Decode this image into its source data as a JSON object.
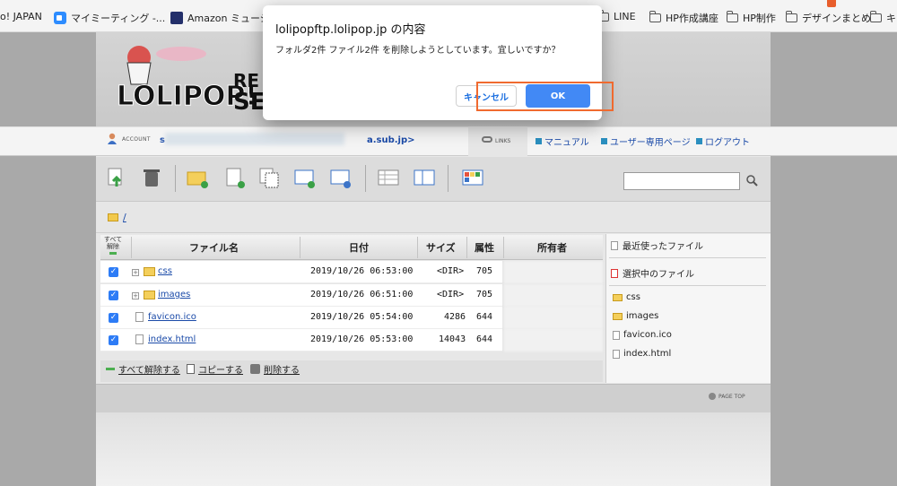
{
  "bookmarks": [
    {
      "label": "o! JAPAN",
      "icon": "yahoo-icon"
    },
    {
      "label": "マイミーティング -...",
      "icon": "zoom-icon"
    },
    {
      "label": "Amazon ミュージ",
      "icon": "amazon-music-icon"
    },
    {
      "label": "LINE",
      "icon": "folder-icon"
    },
    {
      "label": "HP作成講座",
      "icon": "folder-icon"
    },
    {
      "label": "HP制作",
      "icon": "folder-icon"
    },
    {
      "label": "デザインまとめ",
      "icon": "folder-icon"
    },
    {
      "label": "キ",
      "icon": "folder-icon"
    }
  ],
  "header": {
    "account_label": "ACCOUNT",
    "account_prefix": "s",
    "account_suffix": "a.sub.jp>",
    "links_label": "LINKS",
    "nav": [
      "マニュアル",
      "ユーザー専用ページ",
      "ログアウト"
    ]
  },
  "path": "/",
  "table": {
    "unselect_all": [
      "すべて",
      "解除"
    ],
    "columns": [
      "ファイル名",
      "日付",
      "サイズ",
      "属性",
      "所有者"
    ],
    "rows": [
      {
        "name": "css",
        "type": "folder",
        "date": "2019/10/26 06:53:00",
        "size": "<DIR>",
        "perm": "705",
        "checked": true
      },
      {
        "name": "images",
        "type": "folder",
        "date": "2019/10/26 06:51:00",
        "size": "<DIR>",
        "perm": "705",
        "checked": true
      },
      {
        "name": "favicon.ico",
        "type": "file",
        "date": "2019/10/26 05:54:00",
        "size": "4286",
        "perm": "644",
        "checked": true
      },
      {
        "name": "index.html",
        "type": "file",
        "date": "2019/10/26 05:53:00",
        "size": "14043",
        "perm": "644",
        "checked": true
      }
    ]
  },
  "actions": [
    "すべて解除する",
    "コピーする",
    "削除する"
  ],
  "right_panel": {
    "recent_label": "最近使ったファイル",
    "selected_label": "選択中のファイル",
    "selected_files": [
      "css",
      "images",
      "favicon.ico",
      "index.html"
    ]
  },
  "pagetop_label": "PAGE TOP",
  "dialog": {
    "title": "lolipopftp.lolipop.jp の内容",
    "message": "フォルダ2件 ファイル2件 を削除しようとしています。宜しいですか？",
    "cancel_label": "キャンセル",
    "ok_label": "OK"
  },
  "colors": {
    "accent": "#4289f5",
    "highlight": "#f06a2f",
    "link": "#1a4aa8"
  }
}
